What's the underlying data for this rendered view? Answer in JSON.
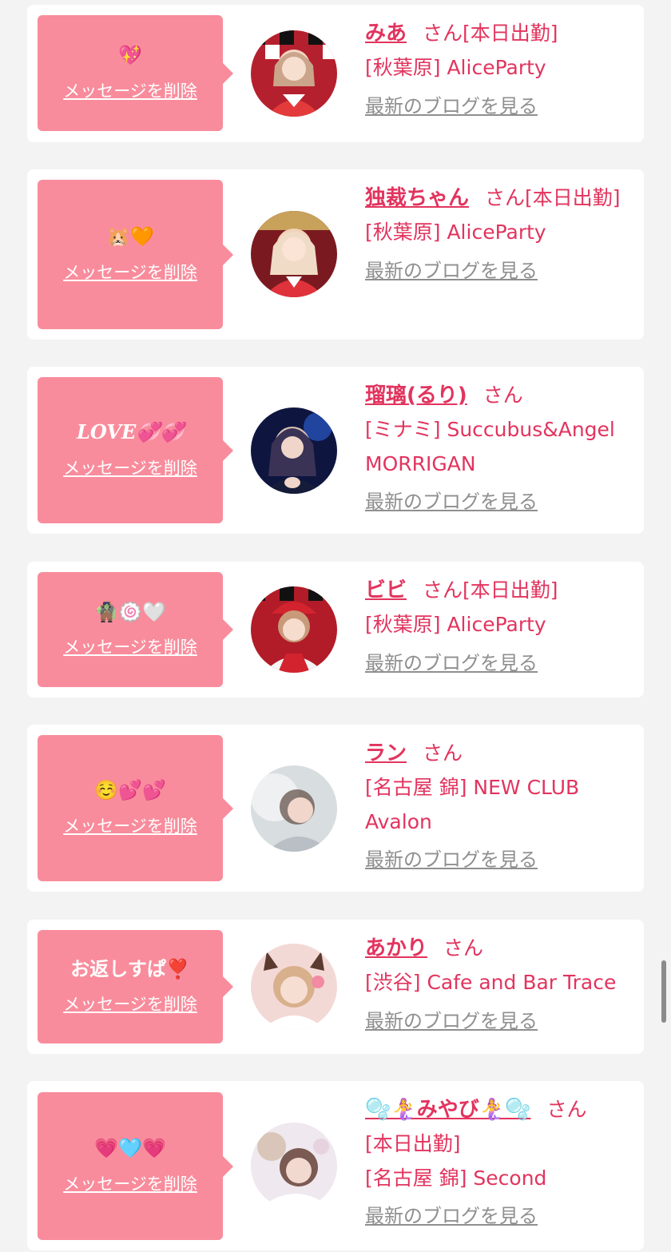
{
  "common": {
    "delete_label": "メッセージを削除",
    "san_suffix": "さん",
    "blog_label": "最新のブログを見る"
  },
  "items": [
    {
      "message": "💖",
      "name": "みあ",
      "attendance": "[本日出勤]",
      "store": "[秋葉原] AliceParty"
    },
    {
      "message": "🐹🧡",
      "name": "独裁ちゃん",
      "attendance": "[本日出勤]",
      "store": "[秋葉原] AliceParty"
    },
    {
      "message": "LOVE💞💞",
      "name": "瑠璃(るり)",
      "attendance": "",
      "store": "[ミナミ] Succubus&Angel MORRIGAN"
    },
    {
      "message": "🧌🍥🤍",
      "name": "ビビ",
      "attendance": "[本日出勤]",
      "store": "[秋葉原] AliceParty"
    },
    {
      "message": "☺️💕💕",
      "name": "ラン",
      "attendance": "",
      "store": "[名古屋 錦] NEW CLUB Avalon"
    },
    {
      "message": "お返しすぱ❣️",
      "name": "あかり",
      "attendance": "",
      "store": "[渋谷] Cafe and Bar Trace"
    },
    {
      "message": "💗🩵💗",
      "name": "🫧🧜‍♀️みやび🧜‍♀️🫧",
      "attendance": "[本日出勤]",
      "store": "[名古屋 錦] Second"
    }
  ],
  "colors": {
    "accent": "#e2345e",
    "bubble": "#f98c9c",
    "background": "#f3f3f3",
    "muted_link": "#8f8f8f"
  }
}
